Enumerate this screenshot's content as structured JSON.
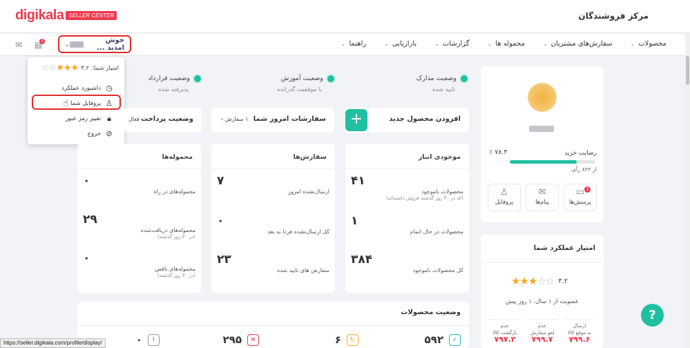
{
  "header": {
    "logo_text": "digikala",
    "logo_badge": "SELLER CENTER",
    "app_title": "مرکز فروشندگان"
  },
  "nav": {
    "items": [
      {
        "label": "محصولات"
      },
      {
        "label": "سفارش‌های مشتریان"
      },
      {
        "label": "محموله ها"
      },
      {
        "label": "گزارشات"
      },
      {
        "label": "بازاریابی"
      },
      {
        "label": "راهنما"
      }
    ],
    "welcome_label": "خوش امدید ...",
    "notification_count": "2"
  },
  "dropdown": {
    "rating_label": "امتیاز شما:",
    "rating_value": "۳.۲",
    "items": [
      {
        "label": "داشبورد عملکرد"
      },
      {
        "label": "پروفایل شما"
      },
      {
        "label": "تغییر رمز عبور"
      },
      {
        "label": "خروج"
      }
    ]
  },
  "profile": {
    "satisfaction_label": "رضایت خرید",
    "satisfaction_pct": "٪ ۷۸.۴",
    "satisfaction_fraction": 0.784,
    "votes": "از ۸۳۳ رأی",
    "quick": [
      {
        "label": "پرسش‌ها",
        "badge": "3"
      },
      {
        "label": "پیام‌ها"
      },
      {
        "label": "پروفایل"
      }
    ]
  },
  "performance": {
    "title": "امتیاز عملکرد شما",
    "score": "۳.۲",
    "membership": "عضویت از ۱ سال، ۱ روز پیش",
    "columns": [
      {
        "label1": "ارسال",
        "label2": "به موقع کالا",
        "value": "۷۹۹.۶"
      },
      {
        "label1": "عدم",
        "label2": "لغو سفارش",
        "value": "۷۹۹.۷"
      },
      {
        "label1": "عدم",
        "label2": "بازگشت کالا",
        "value": "۷۹۷.۲"
      }
    ]
  },
  "statuses": [
    {
      "title": "وضعیت مدارک",
      "sub": "تایید شده"
    },
    {
      "title": "وضعیت آموزش",
      "sub": "با موفقیت گذرانده"
    },
    {
      "title": "وضعیت قرارداد",
      "sub": "پذیرفته شده"
    }
  ],
  "actions": {
    "add_product": "افزودن محصول جدید",
    "today_orders": "سفارشات امروز شما",
    "today_orders_count": "۱ سفارش",
    "payment_status": "وضعیت پرداخت",
    "payment_value": "فعال"
  },
  "inventory": {
    "title": "موجودی انبار",
    "items": [
      {
        "value": "۴۱",
        "label": "محصولات ناموجود",
        "note": "(که در ۳۰ روز گذشته فروش داشته‌اند)"
      },
      {
        "value": "۱",
        "label": "محصولات در حال اتمام",
        "note": ""
      },
      {
        "value": "۳۸۴",
        "label": "کل محصولات ناموجود",
        "note": ""
      }
    ]
  },
  "orders": {
    "title": "سفارش‌ها",
    "items": [
      {
        "value": "۷",
        "label": "ارسال‌نشده امروز"
      },
      {
        "value": "۰",
        "label": "کل ارسال‌نشده فردا به بعد"
      },
      {
        "value": "۲۳",
        "label": "سفارش های تایید شده"
      }
    ]
  },
  "shipments": {
    "title": "محموله‌ها",
    "items": [
      {
        "value": "۰",
        "label": "محموله‌های در راه",
        "note": ""
      },
      {
        "value": "۲۹",
        "label": "محموله‌های دریافت‌شده",
        "note": "(در ۳۰ روز گذشته)"
      },
      {
        "value": "۰",
        "label": "محموله‌های ناقص",
        "note": "(در ۳۰ روز گذشته)"
      }
    ]
  },
  "products_status": {
    "title": "وضعیت محصولات",
    "items": [
      {
        "value": "۵۹۲",
        "icon": "check-icon"
      },
      {
        "value": "۶",
        "icon": "pending-icon"
      },
      {
        "value": "۲۹۵",
        "icon": "reject-icon"
      },
      {
        "value": "۰",
        "icon": "alert-icon"
      }
    ]
  },
  "status_url": "https://seller.digikala.com/profile/display/",
  "colors": {
    "brand": "#ef394e",
    "accent": "#20bfa0",
    "star": "#f9a825"
  }
}
